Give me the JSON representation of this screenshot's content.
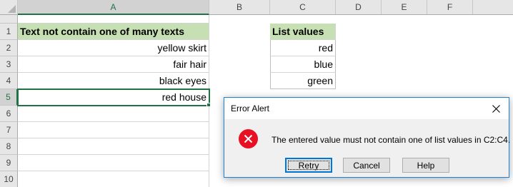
{
  "sheet": {
    "columns": [
      "A",
      "B",
      "C",
      "D",
      "E",
      "F"
    ],
    "selected_column": "A",
    "rows": [
      "1",
      "2",
      "3",
      "4",
      "5",
      "6",
      "7",
      "8",
      "9",
      "10"
    ],
    "selected_row": "5",
    "cells": {
      "A1": "Text not contain one of many texts",
      "A2": "yellow skirt",
      "A3": "fair hair",
      "A4": "black eyes",
      "A5": "red house",
      "C1": "List values",
      "C2": "red",
      "C3": "blue",
      "C4": "green"
    },
    "colors": {
      "header_fill": "#c6e0b4",
      "selection": "#217346"
    }
  },
  "dialog": {
    "title": "Error Alert",
    "message": "The entered value must not contain one of list values in C2:C4.",
    "buttons": {
      "retry": "Retry",
      "cancel": "Cancel",
      "help": "Help"
    },
    "icon": "error-icon",
    "colors": {
      "error": "#e81123",
      "border": "#1883d7"
    }
  }
}
